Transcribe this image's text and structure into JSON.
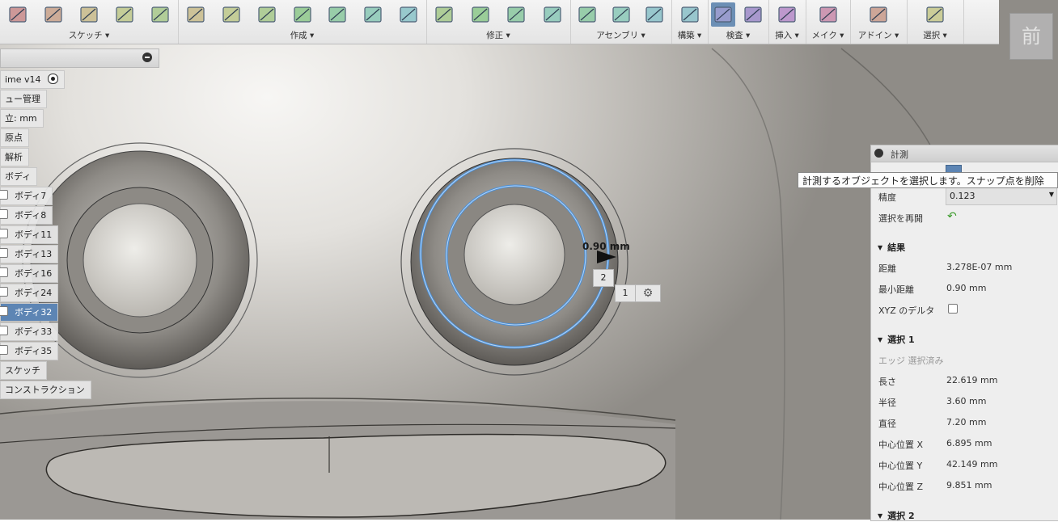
{
  "toolbar": {
    "groups": [
      {
        "label": "スケッチ ▾",
        "icons": [
          "line-icon",
          "circle-icon",
          "rectangle-icon",
          "offset-icon",
          "arc-icon"
        ]
      },
      {
        "label": "作成 ▾",
        "icons": [
          "box-icon",
          "form-icon",
          "pattern-icon",
          "mirror-icon",
          "thicken-icon",
          "boundary-icon",
          "convert-icon"
        ]
      },
      {
        "label": "修正 ▾",
        "icons": [
          "press-pull-icon",
          "fillet-icon",
          "split-icon",
          "scale-icon"
        ]
      },
      {
        "label": "アセンブリ ▾",
        "icons": [
          "new-component-icon",
          "joint-icon",
          "as-built-icon"
        ]
      },
      {
        "label": "構築 ▾",
        "icons": [
          "offset-plane-icon"
        ]
      },
      {
        "label": "検査 ▾",
        "icons": [
          "measure-icon",
          "section-icon"
        ]
      },
      {
        "label": "挿入 ▾",
        "icons": [
          "insert-image-icon"
        ]
      },
      {
        "label": "メイク ▾",
        "icons": [
          "3d-print-icon"
        ]
      },
      {
        "label": "アドイン ▾",
        "icons": [
          "scripts-icon"
        ]
      },
      {
        "label": "選択 ▾",
        "icons": [
          "select-icon"
        ]
      }
    ]
  },
  "view_cube": {
    "label": "前"
  },
  "browser": {
    "title_node": "ime v14",
    "nodes": [
      {
        "label": "ュー管理"
      },
      {
        "label": "立: mm"
      },
      {
        "label": "原点"
      },
      {
        "label": "解析"
      },
      {
        "label": "ボディ"
      }
    ],
    "bodies": [
      {
        "label": "ボディ7",
        "selected": false
      },
      {
        "label": "ボディ8",
        "selected": false
      },
      {
        "label": "ボディ11",
        "selected": false
      },
      {
        "label": "ボディ13",
        "selected": false
      },
      {
        "label": "ボディ16",
        "selected": false
      },
      {
        "label": "ボディ24",
        "selected": false
      },
      {
        "label": "ボディ32",
        "selected": true
      },
      {
        "label": "ボディ33",
        "selected": false
      },
      {
        "label": "ボディ35",
        "selected": false
      }
    ],
    "footer_nodes": [
      {
        "label": "スケッチ"
      },
      {
        "label": "コンストラクション"
      }
    ]
  },
  "viewport": {
    "dimension_text": "0.90 mm",
    "selection_labels": [
      "2",
      "1"
    ]
  },
  "measure_panel": {
    "title": "計測",
    "precision_label": "精度",
    "precision_value": "0.123",
    "reselect_label": "選択を再開",
    "results_title": "結果",
    "distance_label": "距離",
    "distance_value": "3.278E-07 mm",
    "min_distance_label": "最小距離",
    "min_distance_value": "0.90 mm",
    "xyz_delta_label": "XYZ のデルタ",
    "selection1_title": "選択 1",
    "selection1_sub": "エッジ 選択済み",
    "length_label": "長さ",
    "length_value": "22.619 mm",
    "radius_label": "半径",
    "radius_value": "3.60 mm",
    "diameter_label": "直径",
    "diameter_value": "7.20 mm",
    "cx_label": "中心位置 X",
    "cx_value": "6.895 mm",
    "cy_label": "中心位置 Y",
    "cy_value": "42.149 mm",
    "cz_label": "中心位置 Z",
    "cz_value": "9.851 mm",
    "selection2_title": "選択 2"
  },
  "tooltip": {
    "text": "計測するオブジェクトを選択します。スナップ点を削除"
  },
  "colors": {
    "accent": "#5d85b4",
    "selection_edge": "#4a90d9",
    "active_tool": "#6c8fb5"
  }
}
